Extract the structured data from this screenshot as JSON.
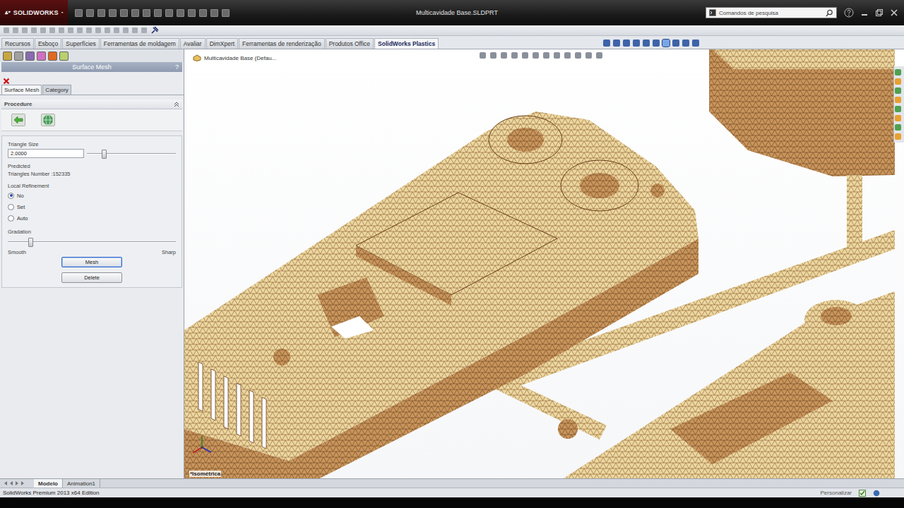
{
  "window": {
    "title": "Multicavidade Base.SLDPRT",
    "logo": "SOLIDWORKS",
    "search": {
      "placeholder": "Comandos de pesquisa"
    }
  },
  "command_tabs": [
    {
      "label": "Recursos",
      "selected": false
    },
    {
      "label": "Esboço",
      "selected": false
    },
    {
      "label": "Superfícies",
      "selected": false
    },
    {
      "label": "Ferramentas de moldagem",
      "selected": false
    },
    {
      "label": "Avaliar",
      "selected": false
    },
    {
      "label": "DimXpert",
      "selected": false
    },
    {
      "label": "Ferramentas de renderização",
      "selected": false
    },
    {
      "label": "Produtos Office",
      "selected": false
    },
    {
      "label": "SolidWorks Plastics",
      "selected": true
    }
  ],
  "property_manager": {
    "title": "Surface Mesh",
    "help": "?",
    "tabs": [
      {
        "label": "Surface Mesh",
        "selected": true
      },
      {
        "label": "Category",
        "selected": false
      }
    ],
    "section": "Procedure",
    "triangle_size": {
      "label": "Triangle Size",
      "value": "2.0000",
      "level": 0.18
    },
    "predicted": "Predicted",
    "triangles_number": "Triangles Number :152335",
    "local_refinement": {
      "label": "Local Refinement",
      "options": [
        {
          "label": "No",
          "selected": true
        },
        {
          "label": "Set",
          "selected": false
        },
        {
          "label": "Auto",
          "selected": false
        }
      ]
    },
    "gradation": {
      "label": "Gradation",
      "level": 0.13,
      "min_label": "Smooth",
      "max_label": "Sharp"
    },
    "buttons": [
      {
        "label": "Mesh",
        "focused": true
      },
      {
        "label": "Delete",
        "focused": false
      }
    ]
  },
  "viewport": {
    "tree_item": "Multicavidade Base (Defau...",
    "view_label": "*Isométrica"
  },
  "bottom_tabs": [
    {
      "label": "Modelo",
      "selected": true
    },
    {
      "label": "Animation1",
      "selected": false
    }
  ],
  "status_bar": {
    "text": "SolidWorks Premium 2013 x64 Edition",
    "right": "Personalizar"
  }
}
